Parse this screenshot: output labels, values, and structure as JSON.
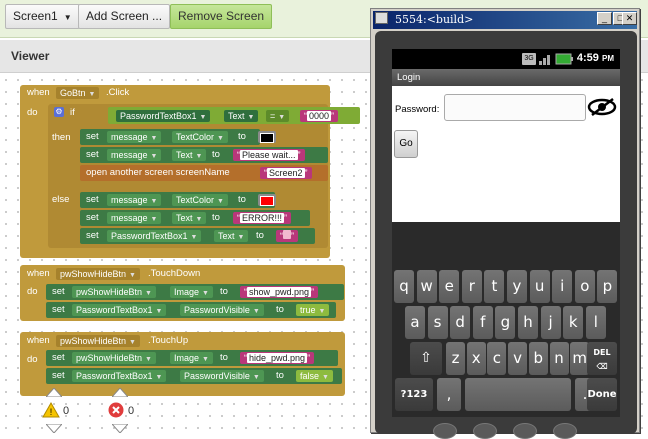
{
  "toolbar": {
    "screen_selector": "Screen1",
    "add_screen": "Add Screen ...",
    "remove_screen": "Remove Screen"
  },
  "viewer": {
    "title": "Viewer"
  },
  "blocks": {
    "event1": {
      "when": "when",
      "component": "GoBtn",
      "event": ".Click",
      "do": "do",
      "if": "if",
      "then": "then",
      "else": "else",
      "cond_component": "PasswordTextBox1",
      "cond_prop": "Text",
      "op": "=",
      "cond_value": "0000",
      "then_rows": [
        {
          "set": "set",
          "component": "message",
          "prop": "TextColor",
          "to": "to",
          "color": "#000000"
        },
        {
          "set": "set",
          "component": "message",
          "prop": "Text",
          "to": "to",
          "value": "Please wait..."
        },
        {
          "label": "open another screen  screenName",
          "value": "Screen2"
        }
      ],
      "else_rows": [
        {
          "set": "set",
          "component": "message",
          "prop": "TextColor",
          "to": "to",
          "color": "#ff0000"
        },
        {
          "set": "set",
          "component": "message",
          "prop": "Text",
          "to": "to",
          "value": "ERROR!!!"
        },
        {
          "set": "set",
          "component": "PasswordTextBox1",
          "prop": "Text",
          "to": "to",
          "value": ""
        }
      ]
    },
    "event2": {
      "when": "when",
      "component": "pwShowHideBtn",
      "event": ".TouchDown",
      "do": "do",
      "rows": [
        {
          "set": "set",
          "component": "pwShowHideBtn",
          "prop": "Image",
          "to": "to",
          "value": "show_pwd.png"
        },
        {
          "set": "set",
          "component": "PasswordTextBox1",
          "prop": "PasswordVisible",
          "to": "to",
          "value": "true"
        }
      ]
    },
    "event3": {
      "when": "when",
      "component": "pwShowHideBtn",
      "event": ".TouchUp",
      "do": "do",
      "rows": [
        {
          "set": "set",
          "component": "pwShowHideBtn",
          "prop": "Image",
          "to": "to",
          "value": "hide_pwd.png"
        },
        {
          "set": "set",
          "component": "PasswordTextBox1",
          "prop": "PasswordVisible",
          "to": "to",
          "value": "false"
        }
      ]
    }
  },
  "counters": {
    "warnings": "0",
    "errors": "0"
  },
  "emulator": {
    "title": "5554:<build>",
    "clock": "4:59",
    "clock_suffix": "PM",
    "network": "3G",
    "app_title": "Login",
    "password_label": "Password:",
    "password_value": "",
    "go_button": "Go",
    "keyboard": {
      "row1": [
        "q",
        "w",
        "e",
        "r",
        "t",
        "y",
        "u",
        "i",
        "o",
        "p"
      ],
      "row2": [
        "a",
        "s",
        "d",
        "f",
        "g",
        "h",
        "j",
        "k",
        "l"
      ],
      "row3": [
        "z",
        "x",
        "c",
        "v",
        "b",
        "n",
        "m"
      ],
      "sym": "?123",
      "comma": ",",
      "period": ".",
      "done": "Done",
      "del": "DEL"
    }
  },
  "colors": {
    "block_event": "#c09a3c",
    "block_set": "#3d7a45",
    "text_block": "#b0306d",
    "toolbar_bg": "#e9f2dc"
  }
}
